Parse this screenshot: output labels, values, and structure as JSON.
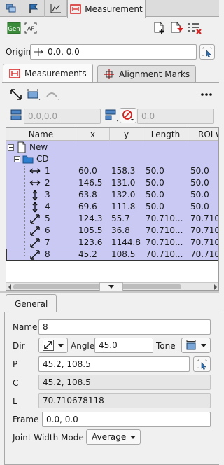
{
  "top_tabs": {
    "active_label": "Measurement"
  },
  "origin": {
    "label": "Origin:",
    "value": "0.0, 0.0"
  },
  "subtabs": {
    "measurements": "Measurements",
    "alignment_marks": "Alignment Marks"
  },
  "toolbar2": {
    "field1_placeholder": "0.0,0.0",
    "field2_placeholder": "0.0"
  },
  "table": {
    "columns": [
      "Name",
      "x",
      "y",
      "Length",
      "ROI w"
    ],
    "root": "New",
    "folder": "CD",
    "rows": [
      {
        "icon": "horizontal-measure-icon",
        "name": "1",
        "x": "60.0",
        "y": "158.3",
        "length": "50.0",
        "roi": "50.0"
      },
      {
        "icon": "horizontal-measure-icon",
        "name": "2",
        "x": "146.5",
        "y": "131.0",
        "length": "50.0",
        "roi": "50.0"
      },
      {
        "icon": "vertical-measure-icon",
        "name": "3",
        "x": "63.8",
        "y": "132.0",
        "length": "50.0",
        "roi": "50.0"
      },
      {
        "icon": "vertical-measure-icon",
        "name": "4",
        "x": "69.6",
        "y": "111.8",
        "length": "50.0",
        "roi": "50.0"
      },
      {
        "icon": "diagonal-measure-icon",
        "name": "5",
        "x": "124.3",
        "y": "55.7",
        "length": "70.710...",
        "roi": "70.710"
      },
      {
        "icon": "diagonal-measure-icon",
        "name": "6",
        "x": "105.5",
        "y": "36.8",
        "length": "70.710...",
        "roi": "70.710"
      },
      {
        "icon": "diagonal-measure-icon",
        "name": "7",
        "x": "123.6",
        "y": "1144.8",
        "length": "70.710...",
        "roi": "70.710"
      },
      {
        "icon": "diagonal-measure-icon",
        "name": "8",
        "x": "45.2",
        "y": "108.5",
        "length": "70.710...",
        "roi": "70.710"
      }
    ]
  },
  "general": {
    "tab_label": "General",
    "name_label": "Name",
    "name_value": "8",
    "dir_label": "Dir",
    "angle_label": "Angle",
    "angle_value": "45.0",
    "tone_label": "Tone",
    "p_label": "P",
    "p_value": "45.2, 108.5",
    "c_label": "C",
    "c_value": "45.2, 108.5",
    "l_label": "L",
    "l_value": "70.710678118",
    "frame_label": "Frame",
    "frame_value": "0.0, 0.0",
    "jwm_label": "Joint Width Mode",
    "jwm_value": "Average"
  },
  "colors": {
    "selection": "#c9c9f4",
    "accent_red": "#d42020",
    "icon_blue": "#1e6fb8",
    "gen_green": "#3a8c3a"
  }
}
